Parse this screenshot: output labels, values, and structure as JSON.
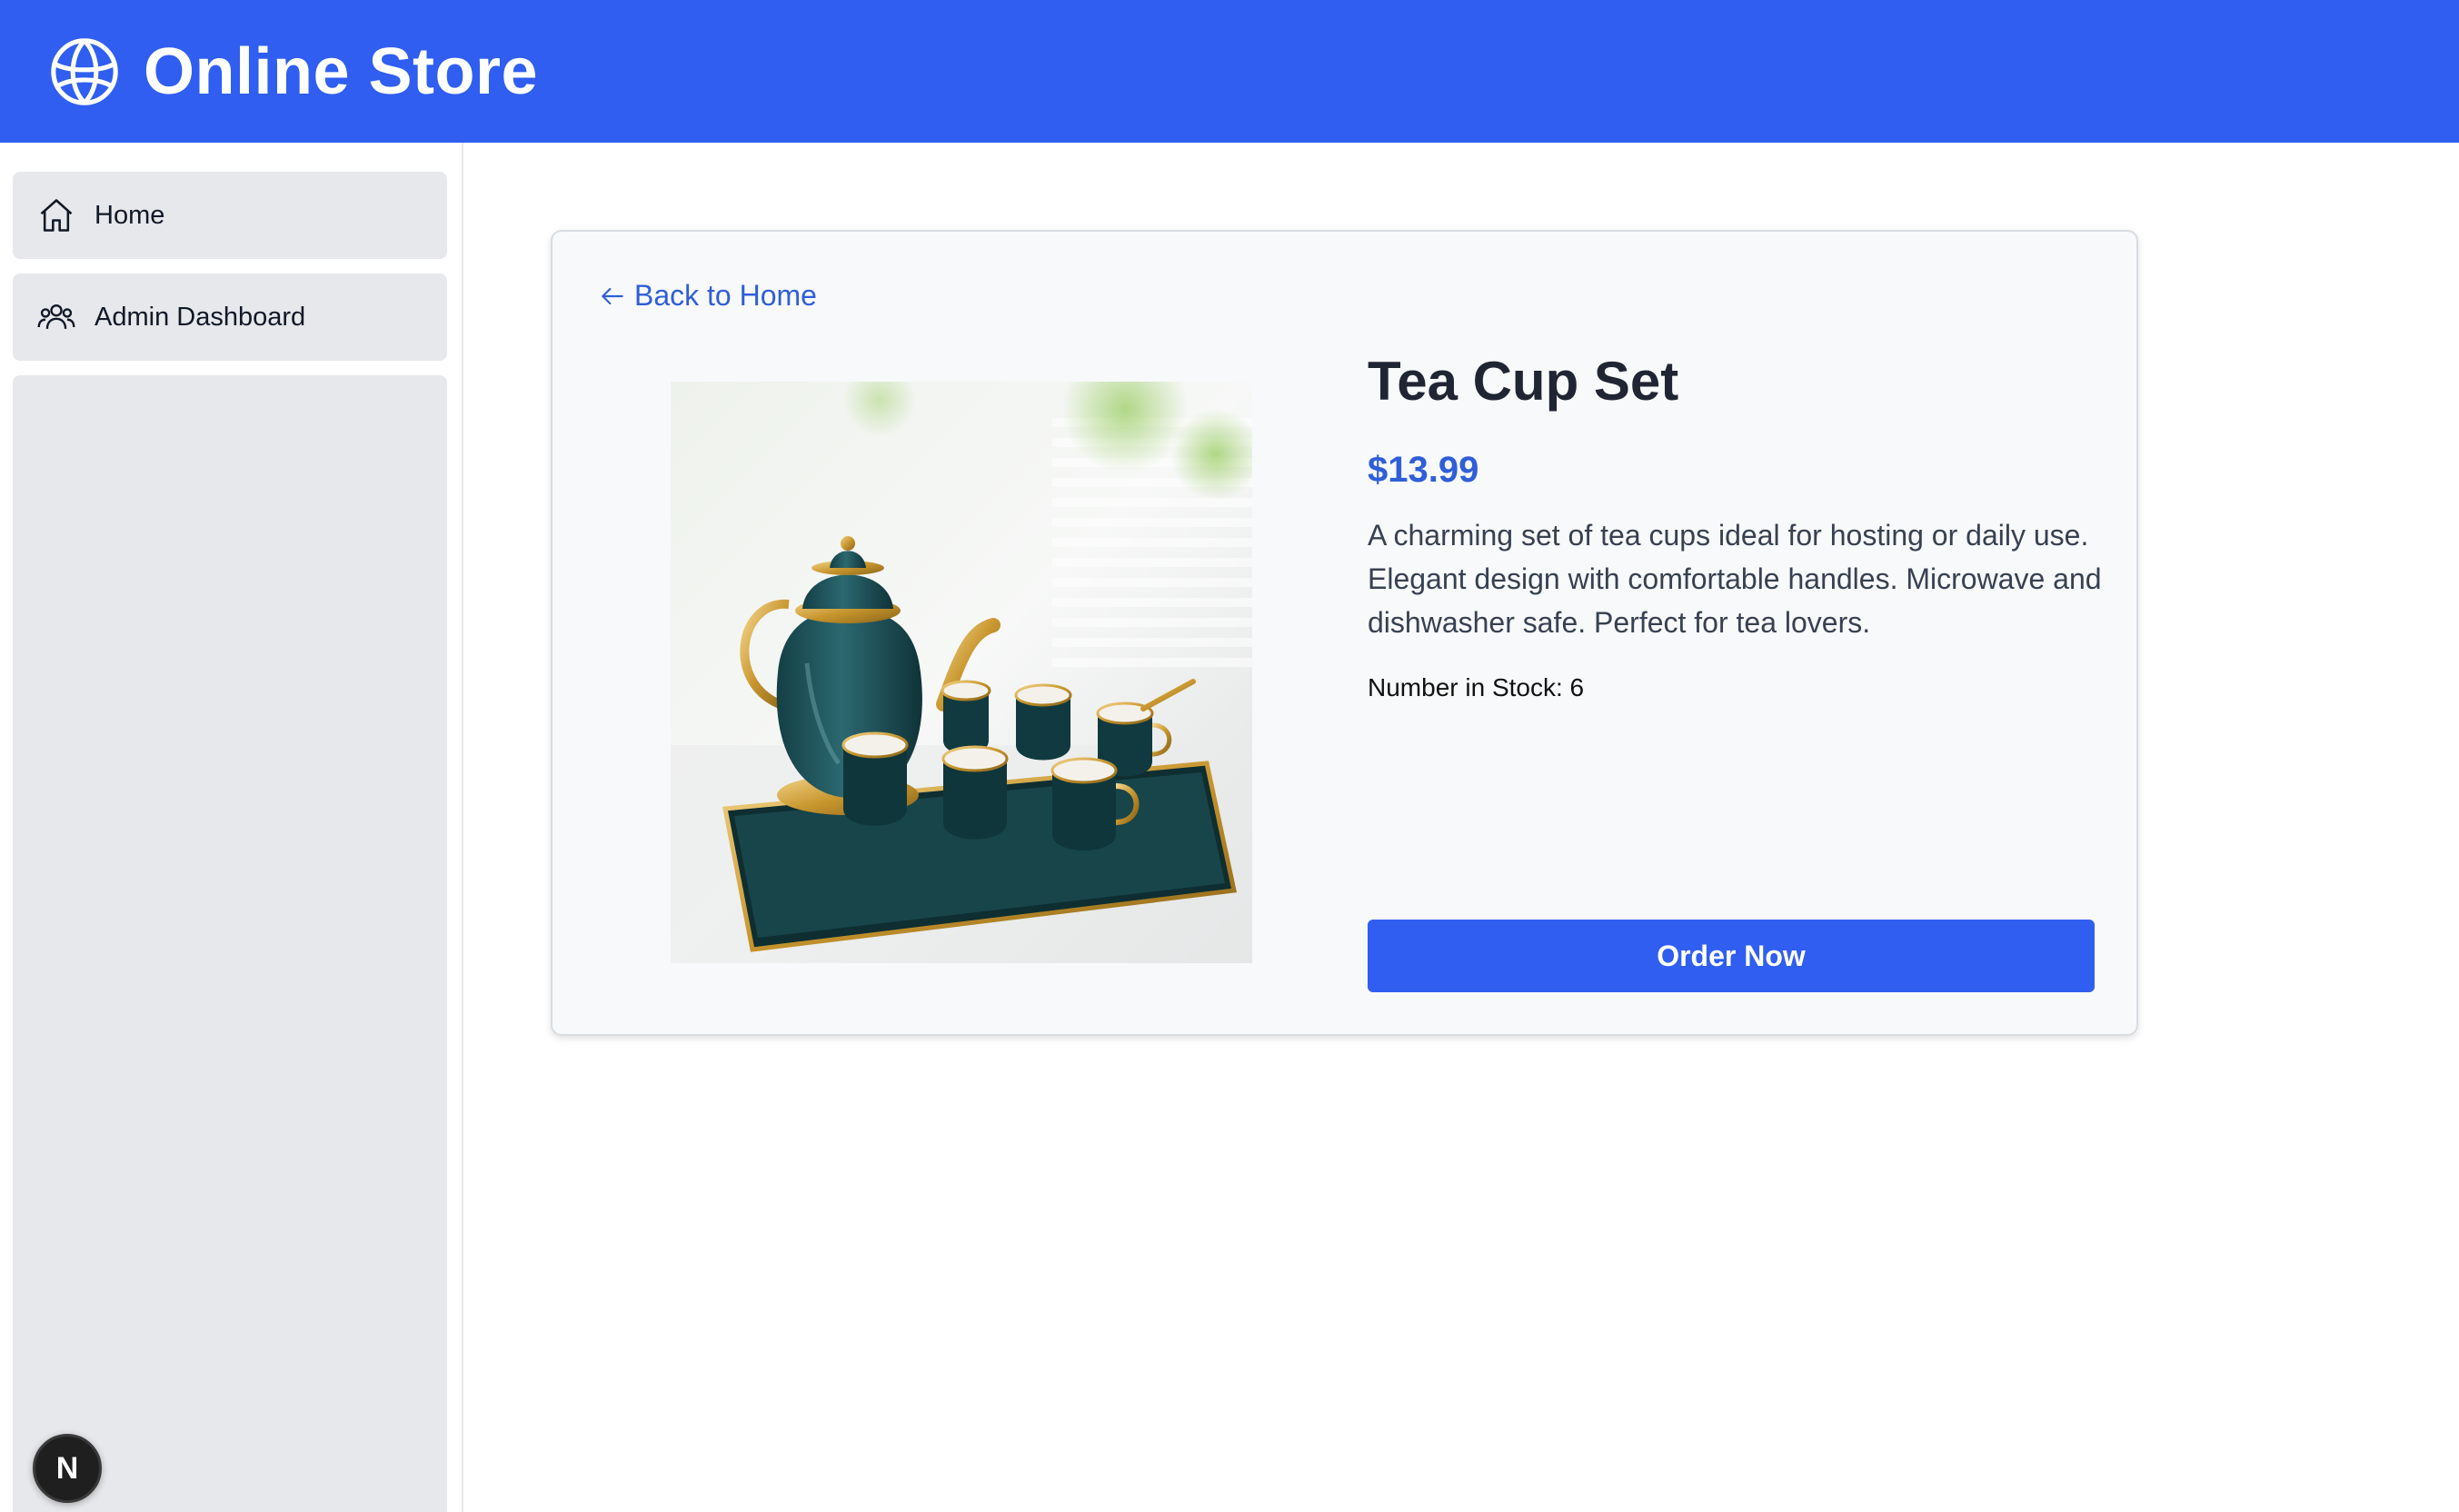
{
  "header": {
    "title": "Online Store",
    "logo_icon": "globe-icon",
    "background": "#2f5ef0"
  },
  "sidebar": {
    "items": [
      {
        "label": "Home",
        "icon": "home-icon"
      },
      {
        "label": "Admin Dashboard",
        "icon": "users-icon"
      }
    ],
    "badge_letter": "N"
  },
  "product": {
    "back_label": "Back to Home",
    "title": "Tea Cup Set",
    "price": "$13.99",
    "description": "A charming set of tea cups ideal for hosting or daily use. Elegant design with comfortable handles. Microwave and dishwasher safe. Perfect for tea lovers.",
    "stock_text": "Number in Stock: 6",
    "order_label": "Order Now",
    "image_alt": "Teapot with six cups on a tray"
  },
  "colors": {
    "accent": "#2f5ef0",
    "link": "#2f5ed8"
  }
}
